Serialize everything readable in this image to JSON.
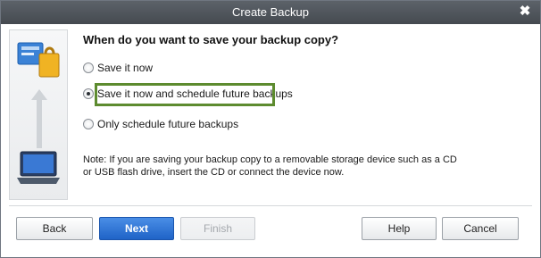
{
  "window": {
    "title": "Create Backup",
    "close_glyph": "✖"
  },
  "sidebar": {
    "icons": [
      "backup-files-icon",
      "up-arrow-icon",
      "laptop-icon"
    ]
  },
  "main": {
    "heading": "When do you want to save your backup copy?",
    "options": [
      {
        "label": "Save it now",
        "checked": false
      },
      {
        "label": "Save it now and schedule future backups",
        "checked": true
      },
      {
        "label": "Only schedule future backups",
        "checked": false
      }
    ],
    "note": "Note: If you are saving your backup copy to a removable storage device such as a CD or USB flash drive, insert the CD or connect the device now."
  },
  "buttons": {
    "back": "Back",
    "next": "Next",
    "finish": "Finish",
    "help": "Help",
    "cancel": "Cancel"
  },
  "colors": {
    "highlight": "#5d8b2f",
    "primary": "#1f63c7"
  }
}
